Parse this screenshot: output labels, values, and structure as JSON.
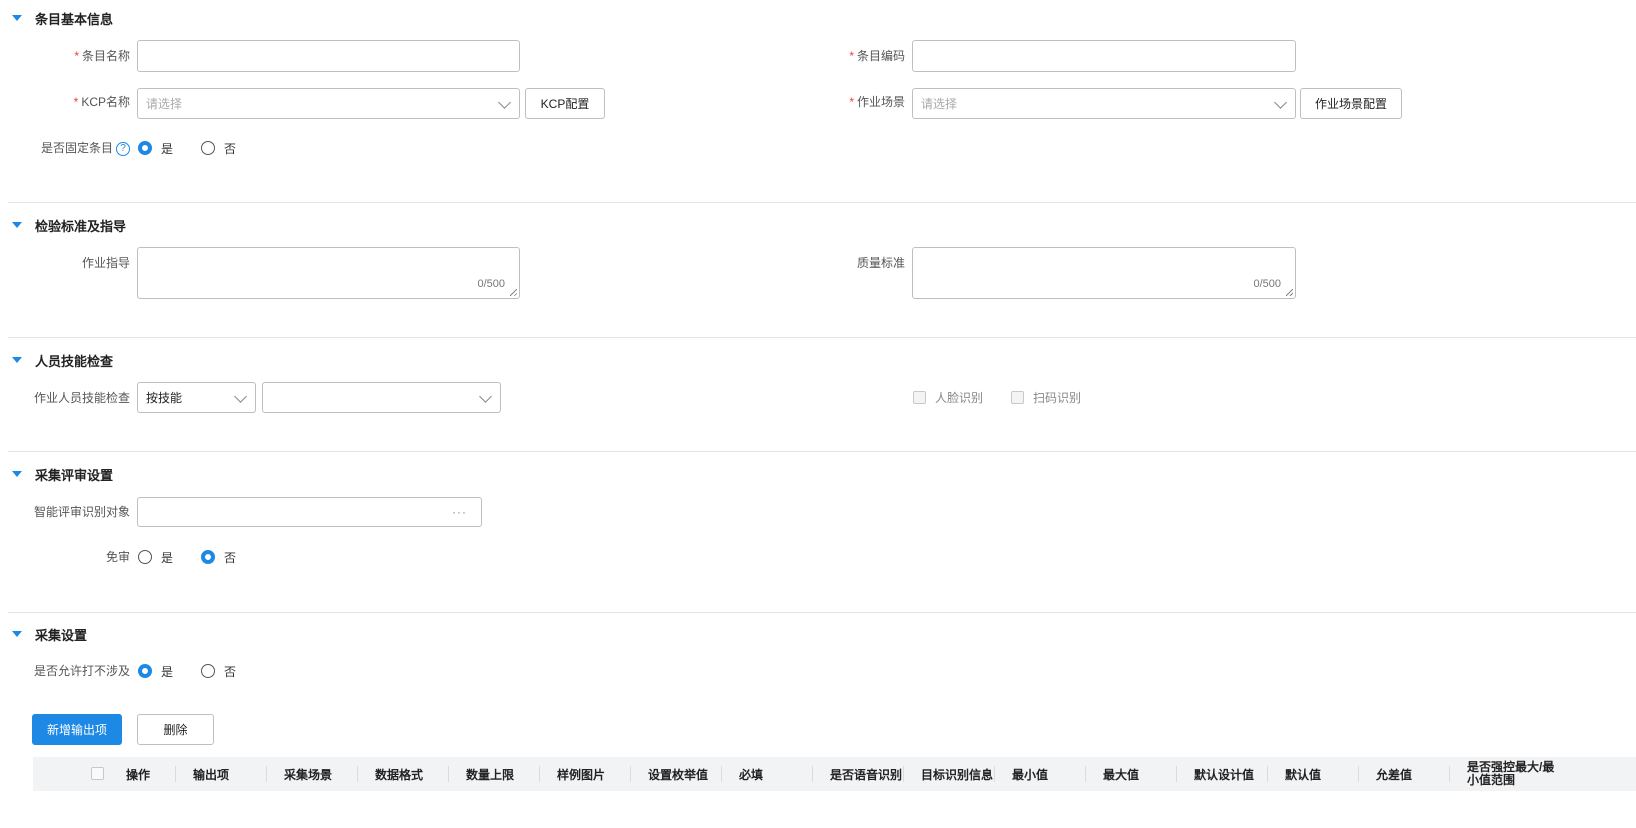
{
  "sections": {
    "basic": "条目基本信息",
    "standard": "检验标准及指导",
    "skill": "人员技能检查",
    "review": "采集评审设置",
    "collect": "采集设置"
  },
  "basic": {
    "item_name_label": "条目名称",
    "item_code_label": "条目编码",
    "kcp_name_label": "KCP名称",
    "kcp_placeholder": "请选择",
    "kcp_config_button": "KCP配置",
    "scene_label": "作业场景",
    "scene_placeholder": "请选择",
    "scene_config_button": "作业场景配置",
    "fixed_label": "是否固定条目",
    "help_glyph": "?",
    "yes": "是",
    "no": "否"
  },
  "standard": {
    "guide_label": "作业指导",
    "guide_count": "0/500",
    "quality_label": "质量标准",
    "quality_count": "0/500"
  },
  "skill": {
    "check_label": "作业人员技能检查",
    "mode_value": "按技能",
    "face_label": "人脸识别",
    "scan_label": "扫码识别"
  },
  "review": {
    "target_label": "智能评审识别对象",
    "ellipsis": "···",
    "exempt_label": "免审",
    "yes": "是",
    "no": "否"
  },
  "collect": {
    "allow_label": "是否允许打不涉及",
    "yes": "是",
    "no": "否",
    "add_button": "新增输出项",
    "delete_button": "删除"
  },
  "table": {
    "columns": [
      "操作",
      "输出项",
      "采集场景",
      "数据格式",
      "数量上限",
      "样例图片",
      "设置枚举值",
      "必填",
      "是否语音识别",
      "目标识别信息",
      "最小值",
      "最大值",
      "默认设计值",
      "默认值",
      "允差值",
      "是否强控最大/最小值范围"
    ]
  },
  "colors": {
    "accent": "#1e88e5",
    "required": "#f03c3c"
  },
  "icons": [
    "caret-down-icon",
    "chevron-down-icon",
    "help-icon",
    "ellipsis-icon"
  ]
}
